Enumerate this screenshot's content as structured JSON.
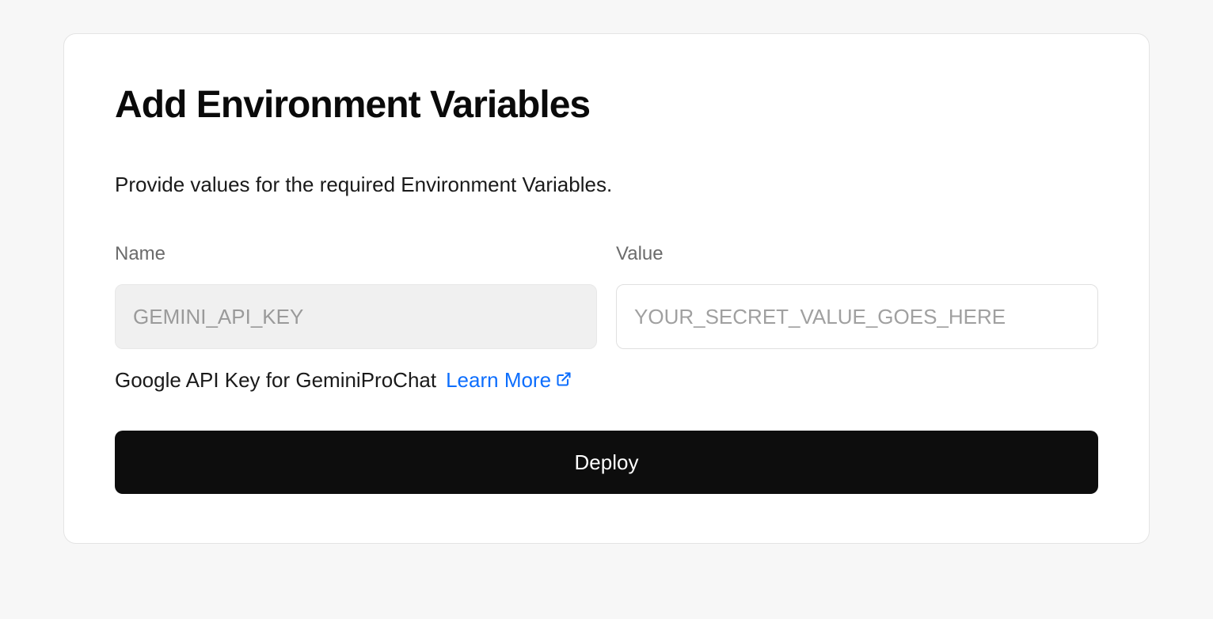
{
  "card": {
    "title": "Add Environment Variables",
    "description": "Provide values for the required Environment Variables.",
    "labels": {
      "name": "Name",
      "value": "Value"
    },
    "fields": {
      "name_value": "GEMINI_API_KEY",
      "value_placeholder": "YOUR_SECRET_VALUE_GOES_HERE"
    },
    "helper": {
      "text": "Google API Key for GeminiProChat",
      "link_text": "Learn More"
    },
    "deploy_button": "Deploy"
  }
}
